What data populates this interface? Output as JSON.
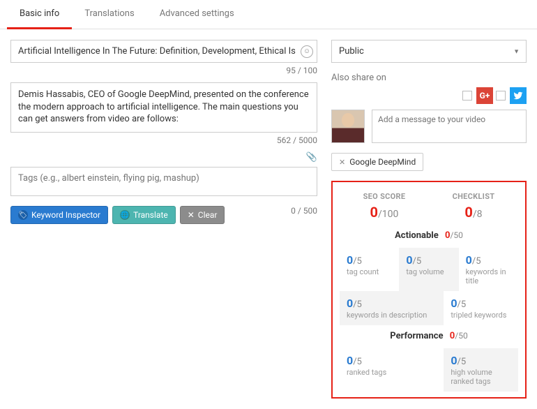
{
  "tabs": {
    "basic": "Basic info",
    "translations": "Translations",
    "advanced": "Advanced settings"
  },
  "title": {
    "value": "Artificial Intelligence In The Future: Definition, Development, Ethical Is",
    "counter": "95 / 100"
  },
  "description": {
    "value": "Demis Hassabis, CEO of Google DeepMind, presented on the conference the modern approach to artificial intelligence. The main questions you can get answers from video are follows:",
    "counter": "562 / 5000"
  },
  "tags": {
    "placeholder": "Tags (e.g., albert einstein, flying pig, mashup)",
    "counter": "0 / 500"
  },
  "buttons": {
    "keyword": "Keyword Inspector",
    "translate": "Translate",
    "clear": "Clear"
  },
  "privacy": {
    "value": "Public"
  },
  "share": {
    "label": "Also share on",
    "msg_placeholder": "Add a message to your video"
  },
  "chip": {
    "label": "Google DeepMind"
  },
  "score": {
    "seo_label": "SEO SCORE",
    "seo_val": "0",
    "seo_max": "/100",
    "check_label": "CHECKLIST",
    "check_val": "0",
    "check_max": "/8",
    "actionable": {
      "title": "Actionable",
      "val": "0",
      "max": "/50"
    },
    "performance": {
      "title": "Performance",
      "val": "0",
      "max": "/50"
    },
    "cells": {
      "tag_count": {
        "v": "0",
        "m": "/5",
        "l": "tag count"
      },
      "tag_volume": {
        "v": "0",
        "m": "/5",
        "l": "tag volume"
      },
      "kw_title": {
        "v": "0",
        "m": "/5",
        "l": "keywords in title"
      },
      "kw_desc": {
        "v": "0",
        "m": "/5",
        "l": "keywords in description"
      },
      "tripled": {
        "v": "0",
        "m": "/5",
        "l": "tripled keywords"
      },
      "ranked": {
        "v": "0",
        "m": "/5",
        "l": "ranked tags"
      },
      "hvranked": {
        "v": "0",
        "m": "/5",
        "l": "high volume ranked tags"
      }
    }
  }
}
